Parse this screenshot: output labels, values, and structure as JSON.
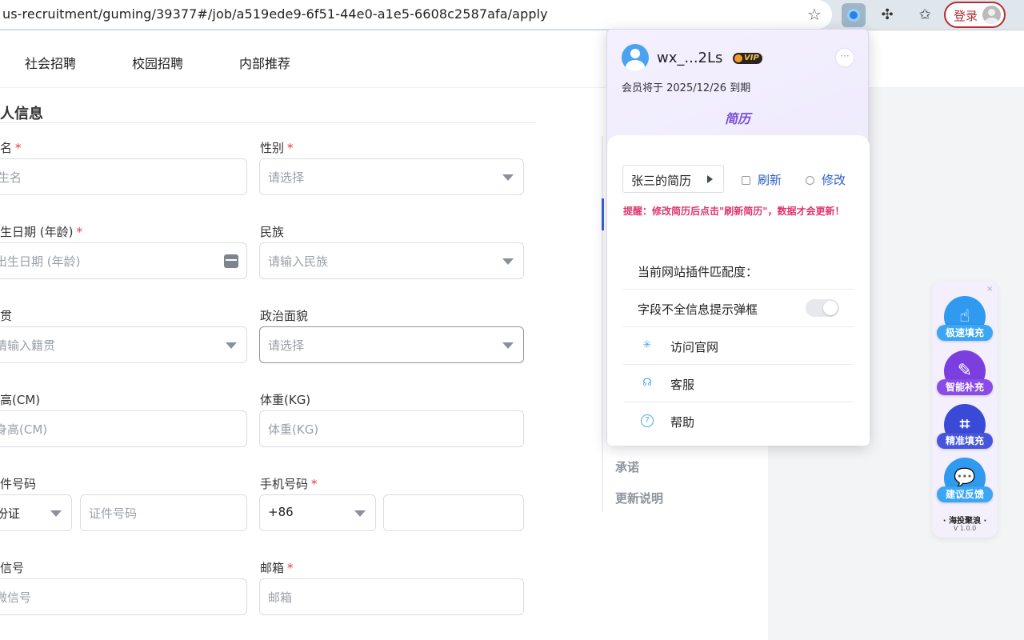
{
  "browser": {
    "url": "us-recruitment/guming/39377#/job/a519ede9-6f51-44e0-a1e5-6608c2587afa/apply",
    "star_icon": "star-icon",
    "login_label": "登录"
  },
  "nav": {
    "items": [
      "社会招聘",
      "校园招聘",
      "内部推荐"
    ]
  },
  "form": {
    "section_title": "人信息",
    "fields": {
      "name": {
        "label": "名",
        "placeholder": "生名"
      },
      "gender": {
        "label": "性别",
        "placeholder": "请选择"
      },
      "birth": {
        "label": "生日期 (年龄)",
        "placeholder": "出生日期 (年龄)"
      },
      "ethnic": {
        "label": "民族",
        "placeholder": "请输入民族"
      },
      "native": {
        "label": "贯",
        "placeholder": "请输入籍贯"
      },
      "political": {
        "label": "政治面貌",
        "placeholder": "请选择"
      },
      "height": {
        "label": "高(CM)",
        "placeholder": "身高(CM)"
      },
      "weight": {
        "label": "体重(KG)",
        "placeholder": "体重(KG)"
      },
      "idtype": {
        "label": "件号码",
        "value": "份证"
      },
      "idnum": {
        "placeholder": "证件号码"
      },
      "phone": {
        "label": "手机号码",
        "code": "+86"
      },
      "wechat": {
        "label": "信号",
        "placeholder": "微信号"
      },
      "email": {
        "label": "邮箱",
        "placeholder": "邮箱"
      }
    }
  },
  "sidebar": {
    "items": [
      "承诺",
      "更新说明"
    ]
  },
  "popup": {
    "username": "wx_...2Ls",
    "vip": "VIP",
    "more": "···",
    "expire": "会员将于 2025/12/26 到期",
    "tab": "简历",
    "resume_name": "张三的简历",
    "refresh": "刷新",
    "edit": "修改",
    "warning": "提醒：修改简历后点击\"刷新简历\"，数据才会更新！",
    "rows": {
      "match": "当前网站插件匹配度：",
      "toggle": "字段不全信息提示弹框",
      "site": "访问官网",
      "service": "客服",
      "help": "帮助"
    }
  },
  "float": {
    "close": "×",
    "buttons": [
      "极速填充",
      "智能补充",
      "精准填充",
      "建议反馈"
    ],
    "brand": "· 海投聚浪 ·",
    "version": "V 1.0.0"
  }
}
